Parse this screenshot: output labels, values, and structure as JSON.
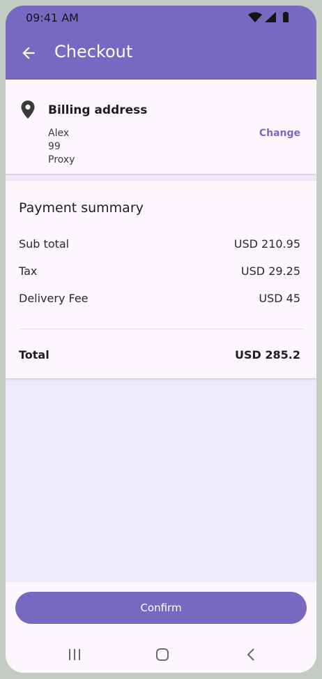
{
  "status_bar": {
    "time": "09:41 AM"
  },
  "app_bar": {
    "title": "Checkout"
  },
  "billing": {
    "title": "Billing address",
    "name": "Alex",
    "line2": "99",
    "line3": "Proxy",
    "change_label": "Change"
  },
  "payment": {
    "title": "Payment summary",
    "rows": [
      {
        "label": "Sub total",
        "value": "USD 210.95"
      },
      {
        "label": "Tax",
        "value": "USD 29.25"
      },
      {
        "label": "Delivery Fee",
        "value": "USD 45"
      }
    ],
    "total_label": "Total",
    "total_value": "USD 285.2"
  },
  "footer": {
    "confirm_label": "Confirm"
  },
  "icons": {
    "back": "arrow-back-icon",
    "location": "location-pin-icon",
    "wifi": "wifi-icon",
    "signal": "signal-icon",
    "battery": "battery-icon"
  },
  "colors": {
    "primary": "#7769c2",
    "surface": "#fdf6fd",
    "background": "#eeeafc"
  }
}
